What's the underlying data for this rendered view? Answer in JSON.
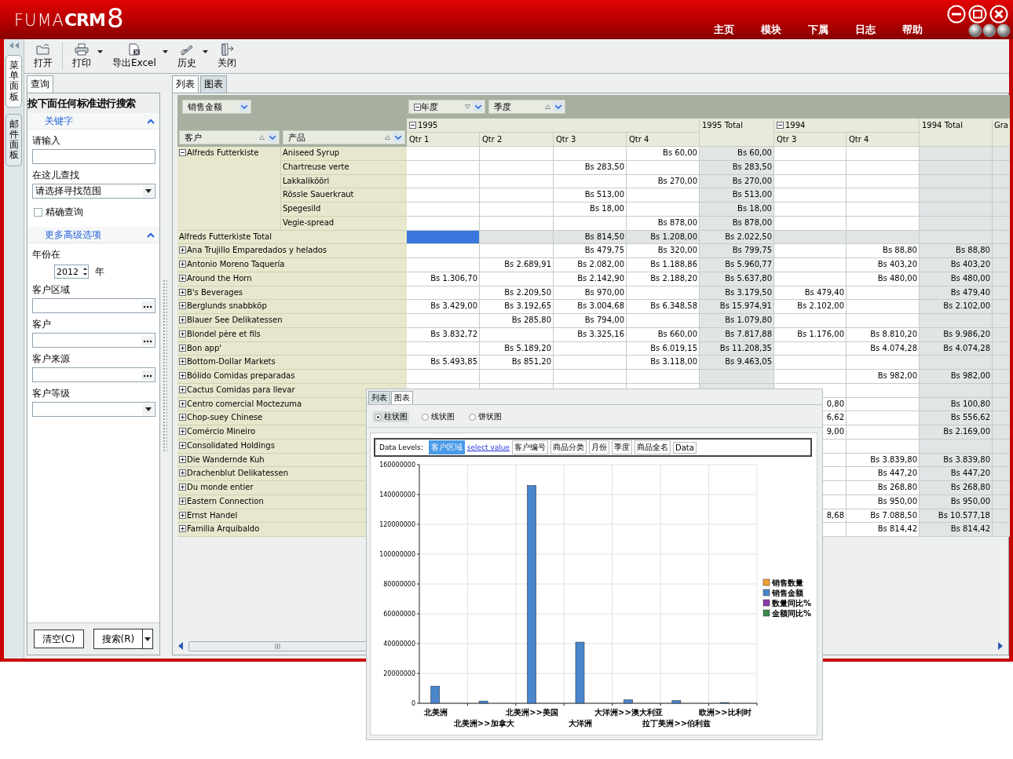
{
  "header": {
    "logo": {
      "light": "FUMA",
      "bold": "CRM",
      "digit": "8"
    },
    "nav": [
      "主页",
      "模块",
      "下属",
      "日志",
      "帮助"
    ]
  },
  "side_tabs": [
    {
      "label": "菜单面板",
      "selected": true
    },
    {
      "label": "邮件面板",
      "selected": false
    }
  ],
  "toolbar": [
    {
      "label": "打开",
      "kind": "folder",
      "menu": false
    },
    {
      "label": "打印",
      "kind": "printer",
      "menu": true
    },
    {
      "label": "导出Excel",
      "kind": "excel",
      "menu": true
    },
    {
      "label": "历史",
      "kind": "pen",
      "menu": true
    },
    {
      "label": "关闭",
      "kind": "exit",
      "menu": false
    }
  ],
  "query_panel": {
    "tab": "查询",
    "title": "按下面任何标准进行搜索",
    "sections": [
      {
        "title": "关键字",
        "expanded": true,
        "fields": [
          {
            "kind": "text",
            "label": "请输入"
          },
          {
            "kind": "select",
            "label": "在这儿查找",
            "value": "请选择寻找范围"
          },
          {
            "kind": "checkbox",
            "label": "精确查询",
            "checked": false
          }
        ]
      },
      {
        "title": "更多高级选项",
        "expanded": true,
        "fields": [
          {
            "kind": "year",
            "label": "年份在",
            "value": "2012",
            "unit": "年"
          },
          {
            "kind": "picker",
            "label": "客户区域"
          },
          {
            "kind": "picker",
            "label": "客户"
          },
          {
            "kind": "picker",
            "label": "客户来源"
          },
          {
            "kind": "select",
            "label": "客户等级"
          }
        ]
      }
    ],
    "buttons": [
      {
        "label": "清空(C)",
        "kind": "plain"
      },
      {
        "label": "搜索(R)",
        "kind": "split"
      }
    ]
  },
  "view_tabs": [
    {
      "label": "列表",
      "selected": true
    },
    {
      "label": "图表",
      "selected": false
    }
  ],
  "pivot": {
    "data_field": "销售金额",
    "row_fields": [
      {
        "label": "客户",
        "descending": false
      },
      {
        "label": "产品",
        "descending": false
      }
    ],
    "column_fields": [
      {
        "label": "年度",
        "descending": true,
        "expanded": true
      },
      {
        "label": "季度",
        "descending": false,
        "expanded": false
      }
    ],
    "years": [
      {
        "label": "1995",
        "expanded": true,
        "quarters": [
          "Qtr 1",
          "Qtr 2",
          "Qtr 3",
          "Qtr 4"
        ],
        "total": "1995 Total"
      },
      {
        "label": "1994",
        "expanded": true,
        "quarters": [
          "Qtr 3",
          "Qtr 4"
        ],
        "total": "1994 Total"
      }
    ],
    "grand_total": "Gra",
    "groups": [
      {
        "customer": "Alfreds Futterkiste",
        "expanded": true,
        "products": [
          {
            "name": "Aniseed Syrup",
            "values": {
              "q4_1995": "Bs 60,00",
              "total_1995": "Bs 60,00"
            }
          },
          {
            "name": "Chartreuse verte",
            "values": {
              "q3_1995": "Bs 283,50",
              "total_1995": "Bs 283,50"
            }
          },
          {
            "name": "Lakkalikööri",
            "values": {
              "q4_1995": "Bs 270,00",
              "total_1995": "Bs 270,00"
            }
          },
          {
            "name": "Rössle Sauerkraut",
            "values": {
              "q3_1995": "Bs 513,00",
              "total_1995": "Bs 513,00"
            }
          },
          {
            "name": "Spegesild",
            "values": {
              "q3_1995": "Bs 18,00",
              "total_1995": "Bs 18,00"
            }
          },
          {
            "name": "Vegie-spread",
            "values": {
              "q4_1995": "Bs 878,00",
              "total_1995": "Bs 878,00"
            }
          }
        ],
        "total": {
          "label": "Alfreds Futterkiste Total",
          "selected": true,
          "values": {
            "q3_1995": "Bs 814,50",
            "q4_1995": "Bs 1.208,00",
            "total_1995": "Bs 2.022,50"
          }
        }
      },
      {
        "customer": "Ana Trujillo Emparedados y helados",
        "expanded": false,
        "values": {
          "q3_1995": "Bs 479,75",
          "q4_1995": "Bs 320,00",
          "total_1995": "Bs 799,75",
          "q4_1994": "Bs 88,80",
          "total_1994": "Bs 88,80"
        }
      },
      {
        "customer": "Antonio Moreno Taquería",
        "expanded": false,
        "values": {
          "q2_1995": "Bs 2.689,91",
          "q3_1995": "Bs 2.082,00",
          "q4_1995": "Bs 1.188,86",
          "total_1995": "Bs 5.960,77",
          "q4_1994": "Bs 403,20",
          "total_1994": "Bs 403,20"
        }
      },
      {
        "customer": "Around the Horn",
        "expanded": false,
        "values": {
          "q1_1995": "Bs 1.306,70",
          "q3_1995": "Bs 2.142,90",
          "q4_1995": "Bs 2.188,20",
          "total_1995": "Bs 5.637,80",
          "q4_1994": "Bs 480,00",
          "total_1994": "Bs 480,00"
        }
      },
      {
        "customer": "B's Beverages",
        "expanded": false,
        "values": {
          "q2_1995": "Bs 2.209,50",
          "q3_1995": "Bs 970,00",
          "total_1995": "Bs 3.179,50",
          "q3_1994": "Bs 479,40",
          "total_1994": "Bs 479,40"
        }
      },
      {
        "customer": "Berglunds snabbköp",
        "expanded": false,
        "values": {
          "q1_1995": "Bs 3.429,00",
          "q2_1995": "Bs 3.192,65",
          "q3_1995": "Bs 3.004,68",
          "q4_1995": "Bs 6.348,58",
          "total_1995": "Bs 15.974,91",
          "q3_1994": "Bs 2.102,00",
          "total_1994": "Bs 2.102,00"
        }
      },
      {
        "customer": "Blauer See Delikatessen",
        "expanded": false,
        "values": {
          "q2_1995": "Bs 285,80",
          "q3_1995": "Bs 794,00",
          "total_1995": "Bs 1.079,80"
        }
      },
      {
        "customer": "Blondel père et fils",
        "expanded": false,
        "values": {
          "q1_1995": "Bs 3.832,72",
          "q3_1995": "Bs 3.325,16",
          "q4_1995": "Bs 660,00",
          "total_1995": "Bs 7.817,88",
          "q3_1994": "Bs 1.176,00",
          "q4_1994": "Bs 8.810,20",
          "total_1994": "Bs 9.986,20"
        }
      },
      {
        "customer": "Bon app'",
        "expanded": false,
        "values": {
          "q2_1995": "Bs 5.189,20",
          "q4_1995": "Bs 6.019,15",
          "total_1995": "Bs 11.208,35",
          "q4_1994": "Bs 4.074,28",
          "total_1994": "Bs 4.074,28"
        }
      },
      {
        "customer": "Bottom-Dollar Markets",
        "expanded": false,
        "values": {
          "q1_1995": "Bs 5.493,85",
          "q2_1995": "Bs 851,20",
          "q4_1995": "Bs 3.118,00",
          "total_1995": "Bs 9.463,05"
        }
      },
      {
        "customer": "Bólido Comidas preparadas",
        "expanded": false,
        "values": {
          "q4_1994": "Bs 982,00",
          "total_1994": "Bs 982,00"
        }
      },
      {
        "customer": "Cactus Comidas para llevar",
        "expanded": false
      },
      {
        "customer": "Centro comercial Moctezuma",
        "expanded": false,
        "values": {
          "q3_1994": "0,80",
          "total_1994": "Bs 100,80"
        }
      },
      {
        "customer": "Chop-suey Chinese",
        "expanded": false,
        "values": {
          "q3_1994": "6,62",
          "total_1994": "Bs 556,62"
        }
      },
      {
        "customer": "Comércio Mineiro",
        "expanded": false,
        "values": {
          "q3_1994": "9,00",
          "total_1994": "Bs 2.169,00"
        }
      },
      {
        "customer": "Consolidated Holdings",
        "expanded": false
      },
      {
        "customer": "Die Wandernde Kuh",
        "expanded": false,
        "values": {
          "q4_1994": "Bs 3.839,80",
          "total_1994": "Bs 3.839,80"
        }
      },
      {
        "customer": "Drachenblut Delikatessen",
        "expanded": false,
        "values": {
          "q4_1994": "Bs 447,20",
          "total_1994": "Bs 447,20"
        }
      },
      {
        "customer": "Du monde entier",
        "expanded": false,
        "values": {
          "q4_1994": "Bs 268,80",
          "total_1994": "Bs 268,80"
        }
      },
      {
        "customer": "Eastern Connection",
        "expanded": false,
        "values": {
          "q4_1994": "Bs 950,00",
          "total_1994": "Bs 950,00"
        }
      },
      {
        "customer": "Ernst Handel",
        "expanded": false,
        "values": {
          "q3_1994": "8,68",
          "q4_1994": "Bs 7.088,50",
          "total_1994": "Bs 10.577,18"
        }
      },
      {
        "customer": "Familia Arquibaldo",
        "expanded": false,
        "values": {
          "q4_1994": "Bs 814,42",
          "total_1994": "Bs 814,42"
        }
      }
    ]
  },
  "chart_window": {
    "tabs": [
      {
        "label": "列表",
        "selected": false
      },
      {
        "label": "图表",
        "selected": true
      }
    ],
    "chart_types": [
      {
        "label": "柱状图",
        "selected": true
      },
      {
        "label": "线状图",
        "selected": false
      },
      {
        "label": "饼状图",
        "selected": false
      }
    ],
    "data_levels": {
      "label": "Data Levels:",
      "items": [
        {
          "label": "客户区域",
          "kind": "chip",
          "selected": true
        },
        {
          "label": "select value",
          "kind": "link"
        },
        {
          "label": "客户编号",
          "kind": "chip",
          "selected": false
        },
        {
          "label": "商品分类",
          "kind": "chip",
          "selected": false
        },
        {
          "label": "月份",
          "kind": "chip",
          "selected": false
        },
        {
          "label": "季度",
          "kind": "chip",
          "selected": false
        },
        {
          "label": "商品全名",
          "kind": "chip",
          "selected": false
        },
        {
          "label": "Data",
          "kind": "chip",
          "selected": false
        }
      ]
    },
    "chart_data": {
      "type": "bar",
      "grid": true,
      "categories": [
        "北美洲",
        "北美洲>>加拿大",
        "北美洲>>美国",
        "大洋洲",
        "大洋洲>>澳大利亚",
        "拉丁美洲>>伯利兹",
        "欧洲>>比利时"
      ],
      "ylim": [
        0,
        160000000
      ],
      "yticks": [
        0,
        20000000,
        40000000,
        60000000,
        80000000,
        100000000,
        120000000,
        140000000,
        160000000
      ],
      "series": [
        {
          "name": "销售数量",
          "color": "#f0a030",
          "values": [
            null,
            null,
            null,
            null,
            null,
            null,
            null
          ]
        },
        {
          "name": "销售金额",
          "color": "#4a86cc",
          "values": [
            11500000,
            1500000,
            146000000,
            41000000,
            2300000,
            1800000,
            500000
          ]
        },
        {
          "name": "数量同比%",
          "color": "#8a3aa8",
          "values": [
            null,
            null,
            null,
            null,
            null,
            null,
            null
          ]
        },
        {
          "name": "金额同比%",
          "color": "#3c8a4a",
          "values": [
            null,
            null,
            null,
            null,
            null,
            null,
            null
          ]
        }
      ]
    }
  }
}
